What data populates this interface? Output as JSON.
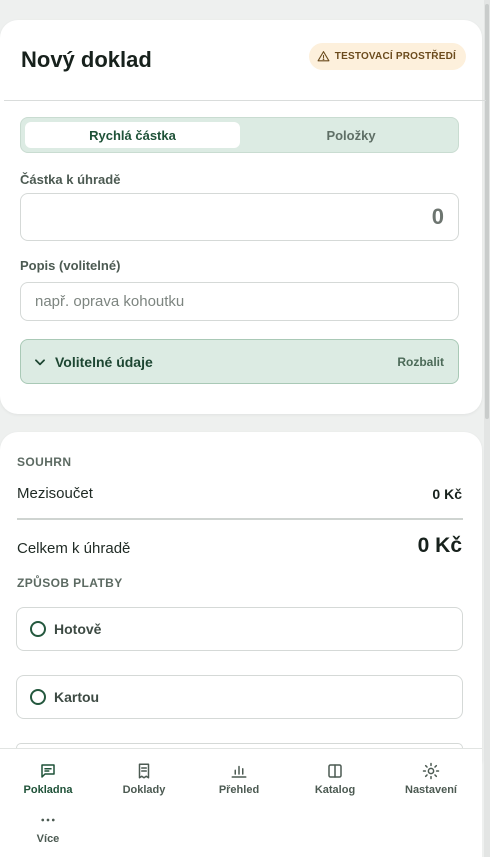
{
  "header": {
    "title": "Nový doklad",
    "env_badge": "TESTOVACÍ PROSTŘEDÍ"
  },
  "mode_tabs": {
    "quick": "Rychlá částka",
    "items": "Položky",
    "active": "quick"
  },
  "amount": {
    "label": "Částka k úhradě",
    "value": "0"
  },
  "description": {
    "label": "Popis (volitelné)",
    "value": "",
    "placeholder": "např. oprava kohoutku"
  },
  "optional_panel": {
    "title": "Volitelné údaje",
    "action": "Rozbalit"
  },
  "summary": {
    "section_label": "SOUHRN",
    "subtotal_label": "Mezisoučet",
    "subtotal_value": "0 Kč",
    "total_label": "Celkem k úhradě",
    "total_value": "0 Kč"
  },
  "payment": {
    "section_label": "ZPŮSOB PLATBY",
    "options": [
      {
        "label": "Hotově",
        "selected": false
      },
      {
        "label": "Kartou",
        "selected": false
      }
    ]
  },
  "nav": {
    "items": [
      {
        "label": "Pokladna",
        "icon": "message-square-icon",
        "active": true
      },
      {
        "label": "Doklady",
        "icon": "receipt-icon",
        "active": false
      },
      {
        "label": "Přehled",
        "icon": "bar-chart-icon",
        "active": false
      },
      {
        "label": "Katalog",
        "icon": "book-open-icon",
        "active": false
      },
      {
        "label": "Nastavení",
        "icon": "sun-gear-icon",
        "active": false
      },
      {
        "label": "Více",
        "icon": "more-dots-icon",
        "active": false
      }
    ]
  },
  "colors": {
    "accent": "#1f5238",
    "accent_light": "#dcebe3",
    "warning_bg": "#fdf0dc"
  }
}
